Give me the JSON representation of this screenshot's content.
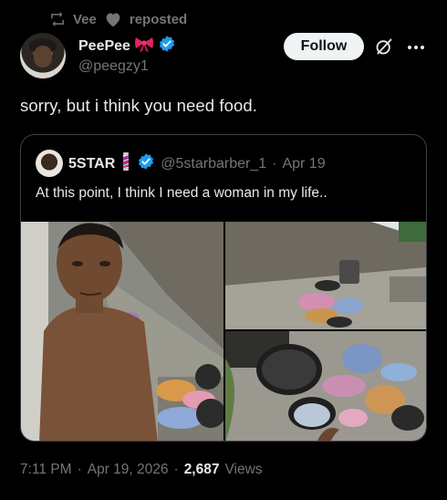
{
  "repost": {
    "user": "Vee",
    "suffix": "reposted"
  },
  "author": {
    "name": "PeePee",
    "handle": "@peegzy1"
  },
  "actions": {
    "follow_label": "Follow"
  },
  "tweet": {
    "text": "sorry, but i think you need food."
  },
  "quoted": {
    "name": "5STAR",
    "handle": "@5starbarber_1",
    "separator": "·",
    "date": "Apr 19",
    "text": "At this point, I think I need a woman in my life.."
  },
  "footer": {
    "time": "7:11 PM",
    "sep1": "·",
    "date": "Apr 19, 2026",
    "sep2": "·",
    "views_count": "2,687",
    "views_label": "Views"
  },
  "colors": {
    "background": "#000000",
    "muted": "#71767b",
    "verified": "#1d9bf0",
    "text": "#e7e9ea"
  },
  "icons": [
    "repost-icon",
    "heart-icon",
    "bow-emoji",
    "verified-icon",
    "grok-icon",
    "more-icon",
    "barber-pole-emoji"
  ]
}
